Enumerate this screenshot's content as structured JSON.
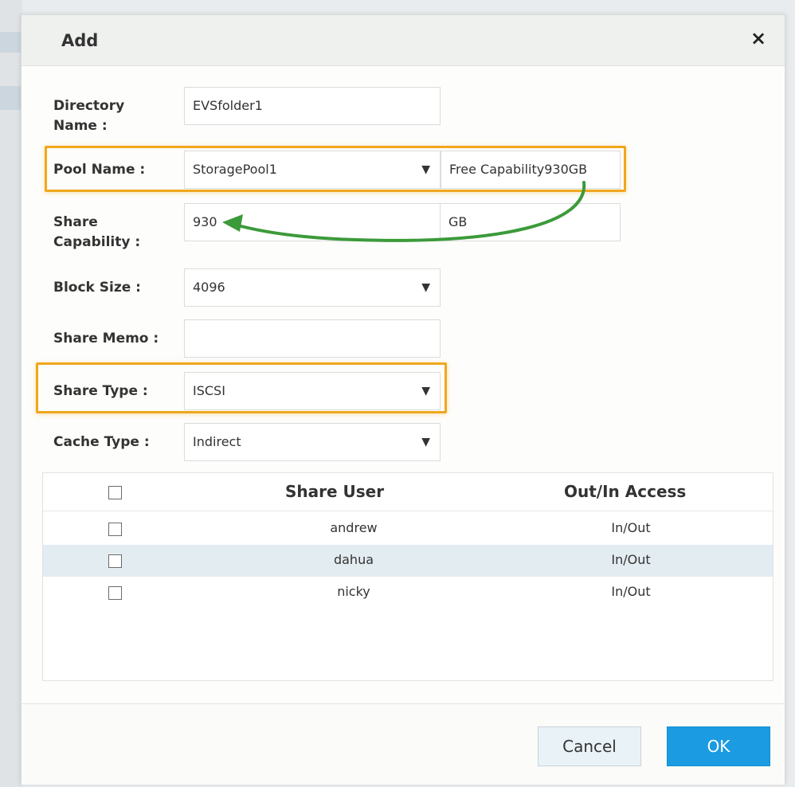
{
  "dialog": {
    "title": "Add",
    "close_glyph": "×",
    "close_icon": "close-icon"
  },
  "form": {
    "directory_name_label": "Directory Name :",
    "directory_name_value": "EVSfolder1",
    "pool_name_label": "Pool Name :",
    "pool_name_value": "StoragePool1",
    "free_capability": "Free Capability930GB",
    "share_capability_label": "Share Capability :",
    "share_capability_value": "930",
    "share_capability_unit": "GB",
    "block_size_label": "Block Size :",
    "block_size_value": "4096",
    "share_memo_label": "Share Memo :",
    "share_memo_value": "",
    "share_type_label": "Share Type :",
    "share_type_value": "ISCSI",
    "cache_type_label": "Cache Type :",
    "cache_type_value": "Indirect",
    "dropdown_caret": "▼"
  },
  "table": {
    "columns": [
      "Share User",
      "Out/In Access"
    ],
    "rows": [
      {
        "user": "andrew",
        "access": "In/Out"
      },
      {
        "user": "dahua",
        "access": "In/Out"
      },
      {
        "user": "nicky",
        "access": "In/Out"
      }
    ]
  },
  "footer": {
    "cancel_label": "Cancel",
    "ok_label": "OK"
  },
  "colors": {
    "highlight": "#f0a71d",
    "arrow": "#3c9a3a",
    "primary_button": "#1a9be2",
    "row_stripe": "#e3ecf1"
  }
}
